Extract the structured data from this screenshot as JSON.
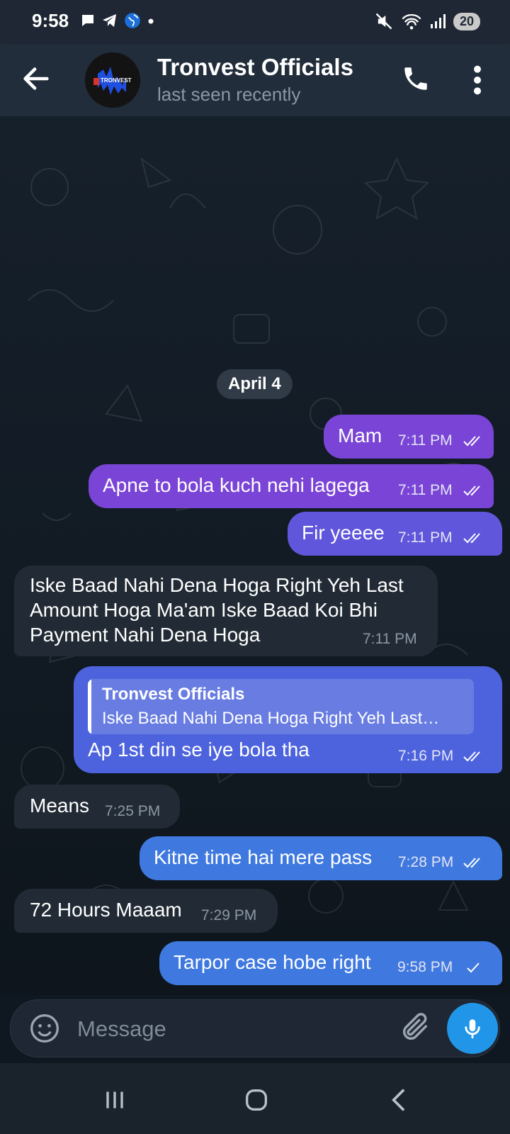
{
  "status_bar": {
    "time": "9:58",
    "battery": "20"
  },
  "header": {
    "title": "Tronvest Officials",
    "subtitle": "last seen recently",
    "avatar_text": "TRONVEST"
  },
  "date_separator": "April 4",
  "messages": [
    {
      "direction": "out",
      "text": "Mam",
      "time": "7:11 PM",
      "status": "read"
    },
    {
      "direction": "out",
      "text": "Apne to bola kuch nehi lagega",
      "time": "7:11 PM",
      "status": "read"
    },
    {
      "direction": "out",
      "text": "Fir yeeee",
      "time": "7:11 PM",
      "status": "read"
    },
    {
      "direction": "in",
      "lines": [
        "Iske Baad Nahi Dena Hoga Right Yeh Last",
        "Amount Hoga Ma'am Iske Baad Koi Bhi",
        "Payment Nahi Dena Hoga"
      ],
      "time": "7:11 PM"
    },
    {
      "direction": "out",
      "reply_to": {
        "name": "Tronvest Officials",
        "text": "Iske Baad Nahi Dena Hoga Right Yeh Last…"
      },
      "text": "Ap 1st din se iye bola tha",
      "time": "7:16 PM",
      "status": "read"
    },
    {
      "direction": "in",
      "text": "Means",
      "time": "7:25 PM"
    },
    {
      "direction": "out",
      "text": "Kitne time hai mere pass",
      "time": "7:28 PM",
      "status": "read"
    },
    {
      "direction": "in",
      "text": "72 Hours Maaam",
      "time": "7:29 PM"
    },
    {
      "direction": "out",
      "text": "Tarpor case hobe right",
      "time": "9:58 PM",
      "status": "sent"
    }
  ],
  "composer": {
    "placeholder": "Message"
  },
  "colors": {
    "accent": "#2196e8",
    "out_bubble_top": "#7a45d6",
    "out_bubble_bottom": "#3f79df",
    "in_bubble": "#222b35"
  }
}
